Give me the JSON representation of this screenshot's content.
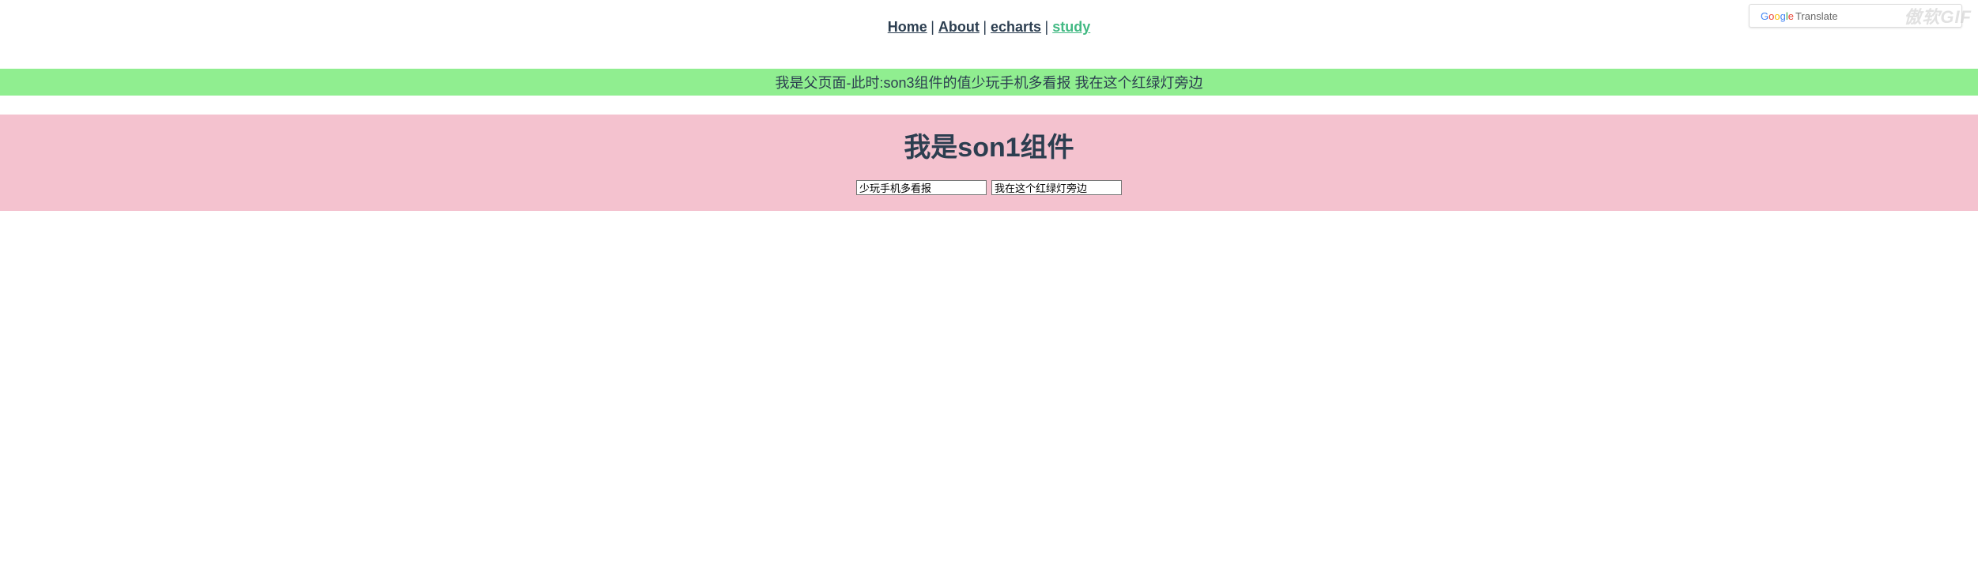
{
  "nav": {
    "home": "Home",
    "about": "About",
    "echarts": "echarts",
    "study": "study",
    "sep": " | "
  },
  "parent_bar": "我是父页面-此时:son3组件的值少玩手机多看报 我在这个红绿灯旁边",
  "son1": {
    "title": "我是son1组件",
    "input1": "少玩手机多看报",
    "input2": "我在这个红绿灯旁边"
  },
  "translate": {
    "google": "Google",
    "label": " Translate"
  },
  "watermark": "傲软GIF"
}
